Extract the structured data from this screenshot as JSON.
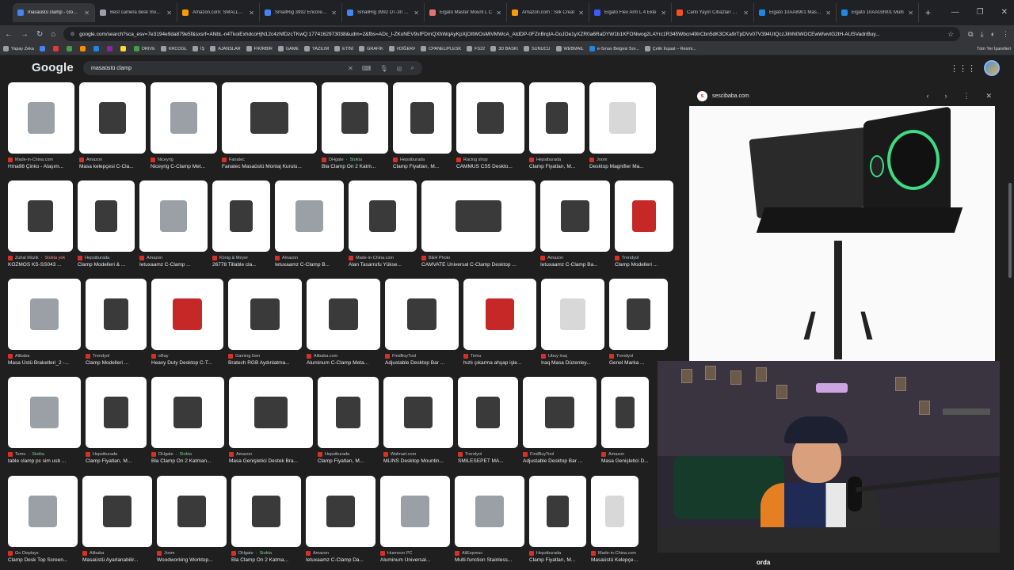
{
  "browser": {
    "tabs": [
      {
        "title": "masaüstü clamp - Google",
        "color": "#4285f4",
        "active": true
      },
      {
        "title": "Best camera desk mounts",
        "color": "#9aa0a6"
      },
      {
        "title": "Amazon.com: SMALLRIG",
        "color": "#ff9900"
      },
      {
        "title": "SmallRig 3992 Encore DT",
        "color": "#4285f4"
      },
      {
        "title": "SmallRig 3992 DT-30 Mo",
        "color": "#4285f4"
      },
      {
        "title": "Elgato Master Mount L C",
        "color": "#e57373"
      },
      {
        "title": "Amazon.com : Silk Creat",
        "color": "#ff9900"
      },
      {
        "title": "Elgato Flex Arm L 4 Ekle",
        "color": "#3d5afe"
      },
      {
        "title": "Canlı Yayın Cihazları Fiya",
        "color": "#f4511e"
      },
      {
        "title": "Elgato 10AA8901 Master",
        "color": "#1e88e5"
      },
      {
        "title": "Elgato 10AAG9901 Multi",
        "color": "#1e88e5"
      }
    ],
    "new_tab": "+",
    "window_controls": [
      "—",
      "❐",
      "✕"
    ],
    "url": "google.com/search?sca_esv=7e3194e9da879e5f&sxsrf=ANbL-n4TkoiExhdcoHjN12c4zNfDzcTKwQ:1774162973038&udm=2&fbs=ADc_l-ZKoNEV9sfFDmQXhWqAyKpXjOItWOsMiVMWcA_AtdDP-0FZnBrqIA-DoJOe1yXZR0a6RaDYW1b1KFONwog2LAYrc1R345Wbcn49IrCbn5dK3CKa9rTpDVv07V394UtQczJiIhN0WOCEwWwvtG2tH-AUSVadnBuy...",
    "bookmarks": [
      {
        "label": "Yapay Zeka",
        "color": "#9aa0a6"
      },
      {
        "label": "",
        "color": "#4285f4"
      },
      {
        "label": "",
        "color": "#e53935"
      },
      {
        "label": "",
        "color": "#43a047"
      },
      {
        "label": "",
        "color": "#fb8c00"
      },
      {
        "label": "",
        "color": "#1e88e5"
      },
      {
        "label": "",
        "color": "#8e24aa"
      },
      {
        "label": "",
        "color": "#fdd835"
      },
      {
        "label": "DRIVE",
        "color": "#43a047"
      },
      {
        "label": "KRCOGL",
        "color": "#9aa0a6"
      },
      {
        "label": "İŞ",
        "color": "#9aa0a6"
      },
      {
        "label": "AJANSLAR",
        "color": "#9aa0a6"
      },
      {
        "label": "FİKİRBİR",
        "color": "#9aa0a6"
      },
      {
        "label": "GAME",
        "color": "#9aa0a6"
      },
      {
        "label": "YAZILIM",
        "color": "#9aa0a6"
      },
      {
        "label": "ETİNİ",
        "color": "#9aa0a6"
      },
      {
        "label": "GRAFİK",
        "color": "#9aa0a6"
      },
      {
        "label": "#DİĞER#",
        "color": "#9aa0a6"
      },
      {
        "label": "CPANEL/PLESK",
        "color": "#9aa0a6"
      },
      {
        "label": "FS22",
        "color": "#9aa0a6"
      },
      {
        "label": "3D BASKI",
        "color": "#9aa0a6"
      },
      {
        "label": "SUNUCU",
        "color": "#9aa0a6"
      },
      {
        "label": "WEBMAIL",
        "color": "#9aa0a6"
      },
      {
        "label": "e-Sınav Belgesi Sor...",
        "color": "#1e88e5"
      },
      {
        "label": "Çelik İnşaat – Resmi...",
        "color": "#9aa0a6"
      }
    ],
    "all_bookmarks": "Tüm Yer İşaretleri"
  },
  "google": {
    "logo": "Google",
    "query": "masaüstü clamp"
  },
  "rows": [
    [
      {
        "w": 84,
        "src": "Made-in-China.com",
        "title": "Hma98 Çinko - Alaşım...",
        "tone": "silver"
      },
      {
        "w": 84,
        "src": "Amazon",
        "title": "Masa kelepçesi C-Cla...",
        "tone": "dark"
      },
      {
        "w": 84,
        "src": "Niceyrig",
        "title": "Niceyrig C-Clamp Met...",
        "tone": "silver"
      },
      {
        "w": 120,
        "src": "Fanatec",
        "title": "Fanatec Masaüstü Montaj Kurulu...",
        "tone": "dark"
      },
      {
        "w": 84,
        "src": "DHgate",
        "stock": "Stokta",
        "title": "Bla Clamp On 2 Katm...",
        "tone": "dark"
      },
      {
        "w": 74,
        "src": "Hepsiburada",
        "title": "Clamp Fiyatları, M...",
        "tone": "dark"
      },
      {
        "w": 86,
        "src": "Racing shop",
        "title": "CAMMUS CS5 Deskto...",
        "tone": "dark"
      },
      {
        "w": 70,
        "src": "Hepsiburada",
        "title": "Clamp Fiyatları, M...",
        "tone": "dark"
      },
      {
        "w": 84,
        "src": "Joom",
        "title": "Desktop Magnifier Ma...",
        "tone": "light"
      }
    ],
    [
      {
        "w": 82,
        "src": "Zuhal Müzik",
        "out": "Stokta yok",
        "title": "KOZMOS KS-SS043 ...",
        "tone": "dark"
      },
      {
        "w": 72,
        "src": "Hepsiburada",
        "title": "Clamp Modelleri & ...",
        "tone": "dark"
      },
      {
        "w": 86,
        "src": "Amazon",
        "title": "Ietuxaamz C-Clamp ...",
        "tone": "silver"
      },
      {
        "w": 73,
        "src": "König & Meyer",
        "title": "26778 Tillable cla...",
        "tone": "dark"
      },
      {
        "w": 87,
        "src": "Amazon",
        "title": "Ietuxaamz C-Clamp B...",
        "tone": "silver"
      },
      {
        "w": 86,
        "src": "Made-in-China.com",
        "title": "Alan Tasarrufu Yükse...",
        "tone": "dark"
      },
      {
        "w": 144,
        "src": "B&H Photo",
        "title": "CAMVATE Universal C-Clamp Desktop ...",
        "tone": "dark"
      },
      {
        "w": 88,
        "src": "Amazon",
        "title": "Ietuxaamz C-Clamp Ba...",
        "tone": "dark"
      },
      {
        "w": 74,
        "src": "Trendyol",
        "title": "Clamp Modelleri ...",
        "tone": "red"
      }
    ],
    [
      {
        "w": 92,
        "src": "Alibaba",
        "title": "Masa Üstü Braketleri_2 -...",
        "tone": "silver"
      },
      {
        "w": 77,
        "src": "Trendyol",
        "title": "Clamp Modelleri ...",
        "tone": "dark"
      },
      {
        "w": 91,
        "src": "eBay",
        "title": "Heavy Duty Desktop C-T...",
        "tone": "red"
      },
      {
        "w": 93,
        "src": "Gaming.Gen",
        "title": "Bratech RGB Aydınlatma...",
        "tone": "dark"
      },
      {
        "w": 93,
        "src": "Alibaba.com",
        "title": "Aluminum C-Clamp Meta...",
        "tone": "dark"
      },
      {
        "w": 93,
        "src": "FindBuyTool",
        "title": "Adjustable Desktop Bar ...",
        "tone": "dark"
      },
      {
        "w": 92,
        "src": "Temu",
        "title": "hızlı çıkarma ahşap işle...",
        "tone": "red"
      },
      {
        "w": 80,
        "src": "Ubuy Iraq",
        "title": "Iraq Masa Düzenley...",
        "tone": "light"
      },
      {
        "w": 74,
        "src": "Trendyol",
        "title": "Genel Marka ...",
        "tone": "dark"
      }
    ],
    [
      {
        "w": 92,
        "src": "Temu",
        "stock": "Stokta",
        "title": "table clamp pc sim usb ...",
        "tone": "silver"
      },
      {
        "w": 77,
        "src": "Hepsiburada",
        "title": "Clamp Fiyatları, M...",
        "tone": "dark"
      },
      {
        "w": 92,
        "src": "DHgate",
        "stock": "Stokta",
        "title": "Bla Clamp On 2 Katman...",
        "tone": "dark"
      },
      {
        "w": 106,
        "src": "Amazon",
        "title": "Masa Genişletici Destek Bra...",
        "tone": "dark"
      },
      {
        "w": 77,
        "src": "Hepsiburada",
        "title": "Clamp Fiyatları, M...",
        "tone": "dark"
      },
      {
        "w": 88,
        "src": "Walmart.com",
        "title": "MLINS Desktop Mountin...",
        "tone": "dark"
      },
      {
        "w": 76,
        "src": "Trendyol",
        "title": "SMILESEPET MA...",
        "tone": "dark"
      },
      {
        "w": 93,
        "src": "FindBuyTool",
        "title": "Adjustable Desktop Bar ...",
        "tone": "dark"
      },
      {
        "w": 60,
        "src": "Amazon",
        "title": "Masa Genişletici D...",
        "tone": "dark"
      }
    ],
    [
      {
        "w": 88,
        "src": "Go Displays",
        "title": "Clamp Desk Top Screen...",
        "tone": "silver"
      },
      {
        "w": 88,
        "src": "Alibaba",
        "title": "Masaüstü Ayarlanabilir...",
        "tone": "dark"
      },
      {
        "w": 88,
        "src": "Joom",
        "title": "Woodworking Worktop...",
        "tone": "dark"
      },
      {
        "w": 88,
        "src": "DHgate",
        "stock": "Stokta",
        "title": "Bla Clamp On 2 Katma...",
        "tone": "dark"
      },
      {
        "w": 88,
        "src": "Amazon",
        "title": "Ietuxaamz C-Clamp Da...",
        "tone": "dark"
      },
      {
        "w": 88,
        "src": "Hueneon PC",
        "title": "Aluminum Universal...",
        "tone": "silver"
      },
      {
        "w": 88,
        "src": "AliExpress",
        "title": "Multi-function Stainless...",
        "tone": "silver"
      },
      {
        "w": 72,
        "src": "Hepsiburada",
        "title": "Clamp Fiyatları, M...",
        "tone": "dark"
      },
      {
        "w": 60,
        "src": "Made-in-China.com",
        "title": "Masaüstü Kelepçesi US...",
        "tone": "light"
      }
    ]
  ],
  "preview": {
    "site": "sescibaba.com",
    "favicon_letter": "s",
    "controls": [
      "‹",
      "›",
      "⋮",
      "✕"
    ]
  },
  "webcam": {
    "caption": "orda"
  }
}
